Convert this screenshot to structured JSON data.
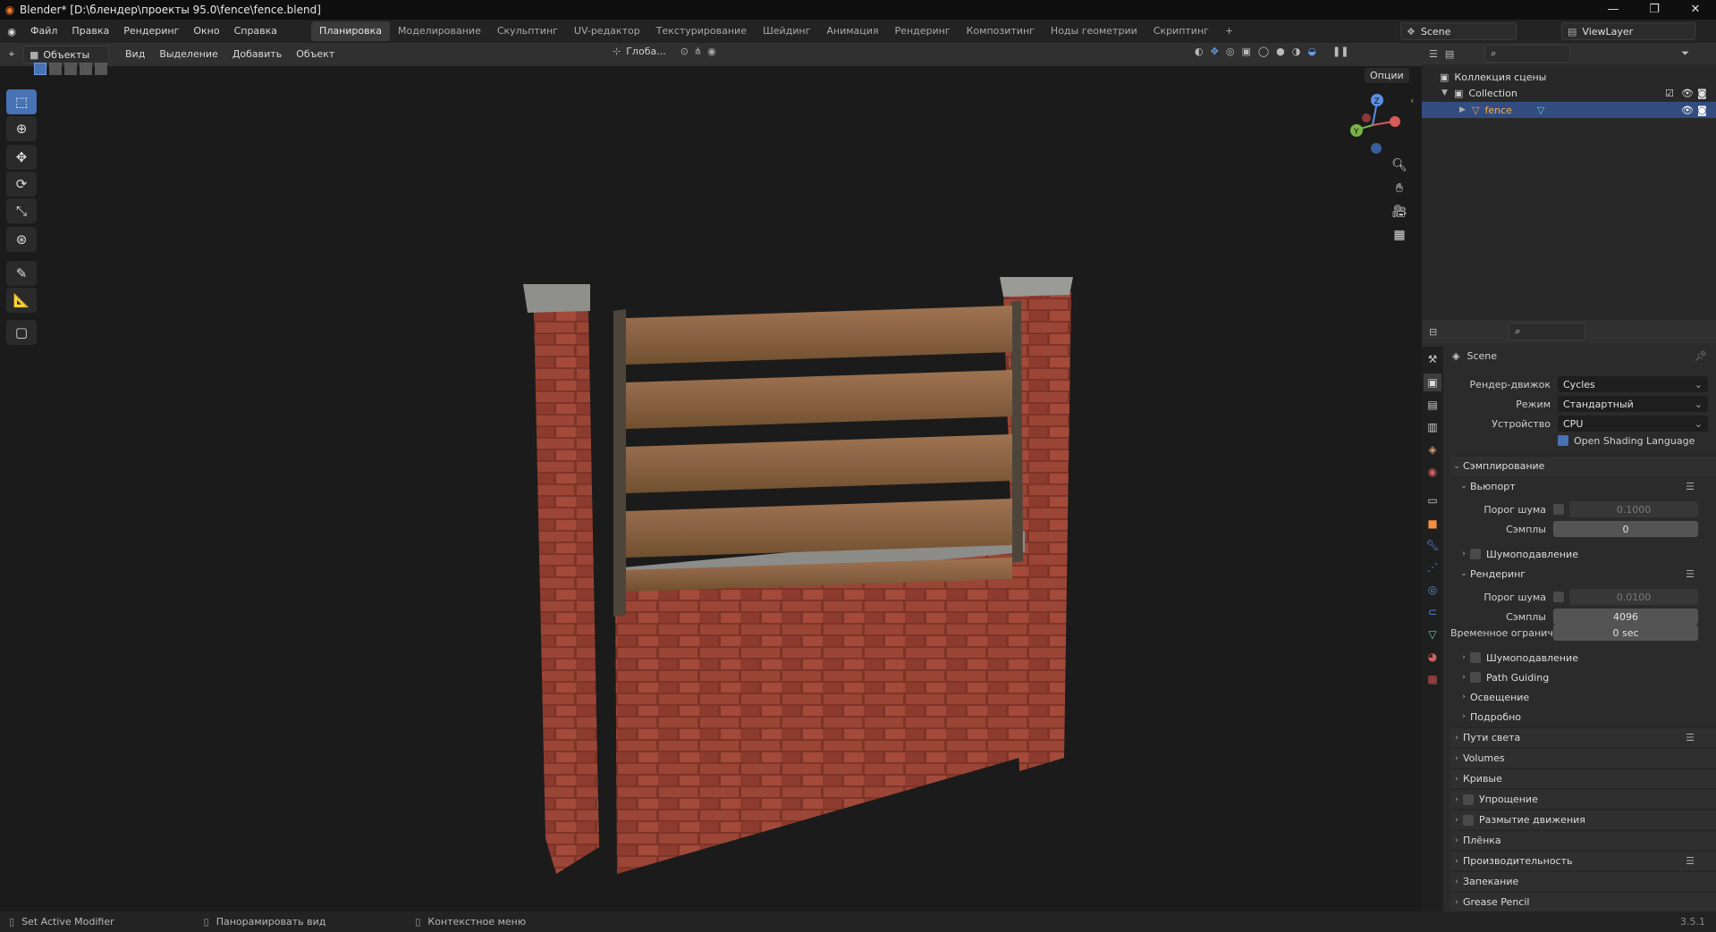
{
  "window": {
    "title": "Blender* [D:\\блендер\\проекты 95.0\\fence\\fence.blend]"
  },
  "menu": [
    "Файл",
    "Правка",
    "Рендеринг",
    "Окно",
    "Справка"
  ],
  "workspaces": [
    "Планировка",
    "Моделирование",
    "Скульптинг",
    "UV-редактор",
    "Текстурирование",
    "Шейдинг",
    "Анимация",
    "Рендеринг",
    "Композитинг",
    "Ноды геометрии",
    "Скриптинг"
  ],
  "scene": {
    "name": "Scene",
    "view_layer": "ViewLayer"
  },
  "viewport": {
    "mode": "Объекты",
    "menus": [
      "Вид",
      "Выделение",
      "Добавить",
      "Объект"
    ],
    "orientation": "Глоба...",
    "options": "Опции"
  },
  "gizmo": {
    "z": "Z",
    "y": "Y",
    "x": "X"
  },
  "outliner": {
    "root": "Коллекция сцены",
    "collection": "Collection",
    "object": "fence"
  },
  "properties": {
    "header": "Scene",
    "engine_label": "Рендер-движок",
    "engine": "Cycles",
    "mode_label": "Режим",
    "mode": "Стандартный",
    "device_label": "Устройство",
    "device": "CPU",
    "osl": "Open Shading Language",
    "sampling": "Сэмплирование",
    "viewport": "Вьюпорт",
    "noise_label": "Порог шума",
    "vp_noise": "0.1000",
    "samples_label": "Сэмплы",
    "vp_samples": "0",
    "denoise": "Шумоподавление",
    "render": "Рендеринг",
    "r_noise": "0.0100",
    "r_samples": "4096",
    "time_label": "Временное огранич...",
    "time": "0 sec",
    "r_denoise": "Шумоподавление",
    "path_guiding": "Path Guiding",
    "lights": "Освещение",
    "advanced": "Подробно",
    "panels": [
      "Пути света",
      "Volumes",
      "Кривые",
      "Упрощение",
      "Размытие движения",
      "Плёнка",
      "Производительность",
      "Запекание",
      "Grease Pencil"
    ]
  },
  "status": {
    "left": "Set Active Modifier",
    "middle": "Панорамировать вид",
    "right": "Контекстное меню",
    "version": "3.5.1"
  }
}
